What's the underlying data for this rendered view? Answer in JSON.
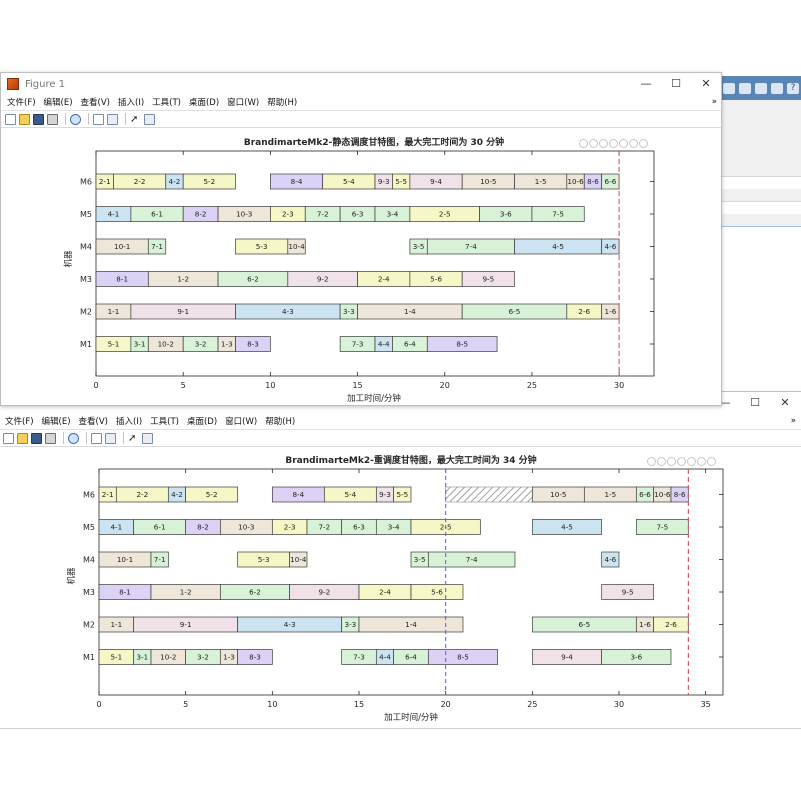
{
  "background_window": {
    "toolbar_icons": [
      "save-icon",
      "undo-icon",
      "redo-icon",
      "window-icon",
      "help-icon"
    ],
    "help_glyph": "?"
  },
  "figure1": {
    "title": "Figure 1",
    "window_controls": {
      "minimize": "—",
      "maximize": "☐",
      "close": "✕"
    },
    "menu": [
      "文件(F)",
      "编辑(E)",
      "查看(V)",
      "插入(I)",
      "工具(T)",
      "桌面(D)",
      "窗口(W)",
      "帮助(H)"
    ],
    "menu_overflow": "»",
    "toolbar_icons": [
      "new-file-icon",
      "open-folder-icon",
      "save-icon",
      "print-icon",
      "zoom-icon",
      "link-icon",
      "data-cursor-icon",
      "pointer-icon",
      "inspector-icon"
    ]
  },
  "figure2": {
    "window_controls": {
      "minimize": "—",
      "maximize": "☐",
      "close": "✕"
    },
    "menu": [
      "文件(F)",
      "编辑(E)",
      "查看(V)",
      "插入(I)",
      "工具(T)",
      "桌面(D)",
      "窗口(W)",
      "帮助(H)"
    ],
    "menu_overflow": "»",
    "toolbar_icons": [
      "new-file-icon",
      "open-folder-icon",
      "save-icon",
      "print-icon",
      "zoom-icon",
      "link-icon",
      "data-cursor-icon",
      "pointer-icon",
      "inspector-icon"
    ]
  },
  "chart_data": [
    {
      "type": "gantt",
      "title": "BrandimarteMk2-静态调度甘特图，最大完工时间为 30 分钟",
      "xlabel": "加工时间/分钟",
      "ylabel": "机器",
      "xlim": [
        0,
        32
      ],
      "xticks": [
        0,
        5,
        10,
        15,
        20,
        25,
        30
      ],
      "machines": [
        "M1",
        "M2",
        "M3",
        "M4",
        "M5",
        "M6"
      ],
      "makespan": 30,
      "makespan_line_color": "#d9534f",
      "tasks": [
        {
          "machine": "M6",
          "label": "2-1",
          "start": 0,
          "end": 1,
          "color": "#f5f7c6"
        },
        {
          "machine": "M6",
          "label": "2-2",
          "start": 1,
          "end": 4,
          "color": "#f5f7c6"
        },
        {
          "machine": "M6",
          "label": "4-2",
          "start": 4,
          "end": 5,
          "color": "#cce3f2"
        },
        {
          "machine": "M6",
          "label": "5-2",
          "start": 5,
          "end": 8,
          "color": "#f5f7c6"
        },
        {
          "machine": "M6",
          "label": "8-4",
          "start": 10,
          "end": 13,
          "color": "#dcd2f5"
        },
        {
          "machine": "M6",
          "label": "5-4",
          "start": 13,
          "end": 16,
          "color": "#f5f7c6"
        },
        {
          "machine": "M6",
          "label": "9-3",
          "start": 16,
          "end": 17,
          "color": "#f0e2e8"
        },
        {
          "machine": "M6",
          "label": "5-5",
          "start": 17,
          "end": 18,
          "color": "#f5f7c6"
        },
        {
          "machine": "M6",
          "label": "9-4",
          "start": 18,
          "end": 21,
          "color": "#f0e2e8"
        },
        {
          "machine": "M6",
          "label": "10-5",
          "start": 21,
          "end": 24,
          "color": "#eee6d8"
        },
        {
          "machine": "M6",
          "label": "1-5",
          "start": 24,
          "end": 27,
          "color": "#eee6d8"
        },
        {
          "machine": "M6",
          "label": "10-6",
          "start": 27,
          "end": 28,
          "color": "#eee6d8"
        },
        {
          "machine": "M6",
          "label": "8-6",
          "start": 28,
          "end": 29,
          "color": "#dcd2f5"
        },
        {
          "machine": "M6",
          "label": "6-6",
          "start": 29,
          "end": 30,
          "color": "#d8f2d8"
        },
        {
          "machine": "M5",
          "label": "4-1",
          "start": 0,
          "end": 2,
          "color": "#cce3f2"
        },
        {
          "machine": "M5",
          "label": "6-1",
          "start": 2,
          "end": 5,
          "color": "#d8f2d8"
        },
        {
          "machine": "M5",
          "label": "8-2",
          "start": 5,
          "end": 7,
          "color": "#dcd2f5"
        },
        {
          "machine": "M5",
          "label": "10-3",
          "start": 7,
          "end": 10,
          "color": "#eee6d8"
        },
        {
          "machine": "M5",
          "label": "2-3",
          "start": 10,
          "end": 12,
          "color": "#f5f7c6"
        },
        {
          "machine": "M5",
          "label": "7-2",
          "start": 12,
          "end": 14,
          "color": "#d8f2d8"
        },
        {
          "machine": "M5",
          "label": "6-3",
          "start": 14,
          "end": 16,
          "color": "#d8f2d8"
        },
        {
          "machine": "M5",
          "label": "3-4",
          "start": 16,
          "end": 18,
          "color": "#d8f2d8"
        },
        {
          "machine": "M5",
          "label": "2-5",
          "start": 18,
          "end": 22,
          "color": "#f5f7c6"
        },
        {
          "machine": "M5",
          "label": "3-6",
          "start": 22,
          "end": 25,
          "color": "#d8f2d8"
        },
        {
          "machine": "M5",
          "label": "7-5",
          "start": 25,
          "end": 28,
          "color": "#d8f2d8"
        },
        {
          "machine": "M4",
          "label": "10-1",
          "start": 0,
          "end": 3,
          "color": "#eee6d8"
        },
        {
          "machine": "M4",
          "label": "7-1",
          "start": 3,
          "end": 4,
          "color": "#d8f2d8"
        },
        {
          "machine": "M4",
          "label": "5-3",
          "start": 8,
          "end": 11,
          "color": "#f5f7c6"
        },
        {
          "machine": "M4",
          "label": "10-4",
          "start": 11,
          "end": 12,
          "color": "#eee6d8"
        },
        {
          "machine": "M4",
          "label": "3-5",
          "start": 18,
          "end": 19,
          "color": "#d8f2d8"
        },
        {
          "machine": "M4",
          "label": "7-4",
          "start": 19,
          "end": 24,
          "color": "#d8f2d8"
        },
        {
          "machine": "M4",
          "label": "4-5",
          "start": 24,
          "end": 29,
          "color": "#cce3f2"
        },
        {
          "machine": "M4",
          "label": "4-6",
          "start": 29,
          "end": 30,
          "color": "#cce3f2"
        },
        {
          "machine": "M3",
          "label": "8-1",
          "start": 0,
          "end": 3,
          "color": "#dcd2f5"
        },
        {
          "machine": "M3",
          "label": "1-2",
          "start": 3,
          "end": 7,
          "color": "#eee6d8"
        },
        {
          "machine": "M3",
          "label": "6-2",
          "start": 7,
          "end": 11,
          "color": "#d8f2d8"
        },
        {
          "machine": "M3",
          "label": "9-2",
          "start": 11,
          "end": 15,
          "color": "#f0e2e8"
        },
        {
          "machine": "M3",
          "label": "2-4",
          "start": 15,
          "end": 18,
          "color": "#f5f7c6"
        },
        {
          "machine": "M3",
          "label": "5-6",
          "start": 18,
          "end": 21,
          "color": "#f5f7c6"
        },
        {
          "machine": "M3",
          "label": "9-5",
          "start": 21,
          "end": 24,
          "color": "#f0e2e8"
        },
        {
          "machine": "M2",
          "label": "1-1",
          "start": 0,
          "end": 2,
          "color": "#eee6d8"
        },
        {
          "machine": "M2",
          "label": "9-1",
          "start": 2,
          "end": 8,
          "color": "#f0e2e8"
        },
        {
          "machine": "M2",
          "label": "4-3",
          "start": 8,
          "end": 14,
          "color": "#cce3f2"
        },
        {
          "machine": "M2",
          "label": "3-3",
          "start": 14,
          "end": 15,
          "color": "#d8f2d8"
        },
        {
          "machine": "M2",
          "label": "1-4",
          "start": 15,
          "end": 21,
          "color": "#eee6d8"
        },
        {
          "machine": "M2",
          "label": "6-5",
          "start": 21,
          "end": 27,
          "color": "#d8f2d8"
        },
        {
          "machine": "M2",
          "label": "2-6",
          "start": 27,
          "end": 29,
          "color": "#f5f7c6"
        },
        {
          "machine": "M2",
          "label": "1-6",
          "start": 29,
          "end": 30,
          "color": "#eee6d8"
        },
        {
          "machine": "M1",
          "label": "5-1",
          "start": 0,
          "end": 2,
          "color": "#f5f7c6"
        },
        {
          "machine": "M1",
          "label": "3-1",
          "start": 2,
          "end": 3,
          "color": "#d8f2d8"
        },
        {
          "machine": "M1",
          "label": "10-2",
          "start": 3,
          "end": 5,
          "color": "#eee6d8"
        },
        {
          "machine": "M1",
          "label": "3-2",
          "start": 5,
          "end": 7,
          "color": "#d8f2d8"
        },
        {
          "machine": "M1",
          "label": "1-3",
          "start": 7,
          "end": 8,
          "color": "#eee6d8"
        },
        {
          "machine": "M1",
          "label": "8-3",
          "start": 8,
          "end": 10,
          "color": "#dcd2f5"
        },
        {
          "machine": "M1",
          "label": "7-3",
          "start": 14,
          "end": 16,
          "color": "#d8f2d8"
        },
        {
          "machine": "M1",
          "label": "4-4",
          "start": 16,
          "end": 17,
          "color": "#cce3f2"
        },
        {
          "machine": "M1",
          "label": "6-4",
          "start": 17,
          "end": 19,
          "color": "#d8f2d8"
        },
        {
          "machine": "M1",
          "label": "8-5",
          "start": 19,
          "end": 23,
          "color": "#dcd2f5"
        }
      ]
    },
    {
      "type": "gantt",
      "title": "BrandimarteMk2-重调度甘特图，最大完工时间为 34 分钟",
      "xlabel": "加工时间/分钟",
      "ylabel": "机器",
      "xlim": [
        0,
        36
      ],
      "xticks": [
        0,
        5,
        10,
        15,
        20,
        25,
        30,
        35
      ],
      "machines": [
        "M1",
        "M2",
        "M3",
        "M4",
        "M5",
        "M6"
      ],
      "makespan": 34,
      "makespan_line_color": "#d9534f",
      "reschedule_time": 20,
      "reschedule_line_color": "#5b6fd6",
      "breakdown": {
        "machine": "M6",
        "start": 20,
        "end": 25
      },
      "tasks": [
        {
          "machine": "M6",
          "label": "2-1",
          "start": 0,
          "end": 1,
          "color": "#f5f7c6"
        },
        {
          "machine": "M6",
          "label": "2-2",
          "start": 1,
          "end": 4,
          "color": "#f5f7c6"
        },
        {
          "machine": "M6",
          "label": "4-2",
          "start": 4,
          "end": 5,
          "color": "#cce3f2"
        },
        {
          "machine": "M6",
          "label": "5-2",
          "start": 5,
          "end": 8,
          "color": "#f5f7c6"
        },
        {
          "machine": "M6",
          "label": "8-4",
          "start": 10,
          "end": 13,
          "color": "#dcd2f5"
        },
        {
          "machine": "M6",
          "label": "5-4",
          "start": 13,
          "end": 16,
          "color": "#f5f7c6"
        },
        {
          "machine": "M6",
          "label": "9-3",
          "start": 16,
          "end": 17,
          "color": "#f0e2e8"
        },
        {
          "machine": "M6",
          "label": "5-5",
          "start": 17,
          "end": 18,
          "color": "#f5f7c6"
        },
        {
          "machine": "M6",
          "label": "10-5",
          "start": 25,
          "end": 28,
          "color": "#eee6d8"
        },
        {
          "machine": "M6",
          "label": "1-5",
          "start": 28,
          "end": 31,
          "color": "#eee6d8"
        },
        {
          "machine": "M6",
          "label": "6-6",
          "start": 31,
          "end": 32,
          "color": "#d8f2d8"
        },
        {
          "machine": "M6",
          "label": "10-6",
          "start": 32,
          "end": 33,
          "color": "#eee6d8"
        },
        {
          "machine": "M6",
          "label": "8-6",
          "start": 33,
          "end": 34,
          "color": "#dcd2f5"
        },
        {
          "machine": "M5",
          "label": "4-1",
          "start": 0,
          "end": 2,
          "color": "#cce3f2"
        },
        {
          "machine": "M5",
          "label": "6-1",
          "start": 2,
          "end": 5,
          "color": "#d8f2d8"
        },
        {
          "machine": "M5",
          "label": "8-2",
          "start": 5,
          "end": 7,
          "color": "#dcd2f5"
        },
        {
          "machine": "M5",
          "label": "10-3",
          "start": 7,
          "end": 10,
          "color": "#eee6d8"
        },
        {
          "machine": "M5",
          "label": "2-3",
          "start": 10,
          "end": 12,
          "color": "#f5f7c6"
        },
        {
          "machine": "M5",
          "label": "7-2",
          "start": 12,
          "end": 14,
          "color": "#d8f2d8"
        },
        {
          "machine": "M5",
          "label": "6-3",
          "start": 14,
          "end": 16,
          "color": "#d8f2d8"
        },
        {
          "machine": "M5",
          "label": "3-4",
          "start": 16,
          "end": 18,
          "color": "#d8f2d8"
        },
        {
          "machine": "M5",
          "label": "2-5",
          "start": 18,
          "end": 22,
          "color": "#f5f7c6"
        },
        {
          "machine": "M5",
          "label": "4-5",
          "start": 25,
          "end": 29,
          "color": "#cce3f2"
        },
        {
          "machine": "M5",
          "label": "7-5",
          "start": 31,
          "end": 34,
          "color": "#d8f2d8"
        },
        {
          "machine": "M4",
          "label": "10-1",
          "start": 0,
          "end": 3,
          "color": "#eee6d8"
        },
        {
          "machine": "M4",
          "label": "7-1",
          "start": 3,
          "end": 4,
          "color": "#d8f2d8"
        },
        {
          "machine": "M4",
          "label": "5-3",
          "start": 8,
          "end": 11,
          "color": "#f5f7c6"
        },
        {
          "machine": "M4",
          "label": "10-4",
          "start": 11,
          "end": 12,
          "color": "#eee6d8"
        },
        {
          "machine": "M4",
          "label": "3-5",
          "start": 18,
          "end": 19,
          "color": "#d8f2d8"
        },
        {
          "machine": "M4",
          "label": "7-4",
          "start": 19,
          "end": 24,
          "color": "#d8f2d8"
        },
        {
          "machine": "M4",
          "label": "4-6",
          "start": 29,
          "end": 30,
          "color": "#cce3f2"
        },
        {
          "machine": "M3",
          "label": "8-1",
          "start": 0,
          "end": 3,
          "color": "#dcd2f5"
        },
        {
          "machine": "M3",
          "label": "1-2",
          "start": 3,
          "end": 7,
          "color": "#eee6d8"
        },
        {
          "machine": "M3",
          "label": "6-2",
          "start": 7,
          "end": 11,
          "color": "#d8f2d8"
        },
        {
          "machine": "M3",
          "label": "9-2",
          "start": 11,
          "end": 15,
          "color": "#f0e2e8"
        },
        {
          "machine": "M3",
          "label": "2-4",
          "start": 15,
          "end": 18,
          "color": "#f5f7c6"
        },
        {
          "machine": "M3",
          "label": "5-6",
          "start": 18,
          "end": 21,
          "color": "#f5f7c6"
        },
        {
          "machine": "M3",
          "label": "9-5",
          "start": 29,
          "end": 32,
          "color": "#f0e2e8"
        },
        {
          "machine": "M2",
          "label": "1-1",
          "start": 0,
          "end": 2,
          "color": "#eee6d8"
        },
        {
          "machine": "M2",
          "label": "9-1",
          "start": 2,
          "end": 8,
          "color": "#f0e2e8"
        },
        {
          "machine": "M2",
          "label": "4-3",
          "start": 8,
          "end": 14,
          "color": "#cce3f2"
        },
        {
          "machine": "M2",
          "label": "3-3",
          "start": 14,
          "end": 15,
          "color": "#d8f2d8"
        },
        {
          "machine": "M2",
          "label": "1-4",
          "start": 15,
          "end": 21,
          "color": "#eee6d8"
        },
        {
          "machine": "M2",
          "label": "6-5",
          "start": 25,
          "end": 31,
          "color": "#d8f2d8"
        },
        {
          "machine": "M2",
          "label": "1-6",
          "start": 31,
          "end": 32,
          "color": "#eee6d8"
        },
        {
          "machine": "M2",
          "label": "2-6",
          "start": 32,
          "end": 34,
          "color": "#f5f7c6"
        },
        {
          "machine": "M1",
          "label": "5-1",
          "start": 0,
          "end": 2,
          "color": "#f5f7c6"
        },
        {
          "machine": "M1",
          "label": "3-1",
          "start": 2,
          "end": 3,
          "color": "#d8f2d8"
        },
        {
          "machine": "M1",
          "label": "10-2",
          "start": 3,
          "end": 5,
          "color": "#eee6d8"
        },
        {
          "machine": "M1",
          "label": "3-2",
          "start": 5,
          "end": 7,
          "color": "#d8f2d8"
        },
        {
          "machine": "M1",
          "label": "1-3",
          "start": 7,
          "end": 8,
          "color": "#eee6d8"
        },
        {
          "machine": "M1",
          "label": "8-3",
          "start": 8,
          "end": 10,
          "color": "#dcd2f5"
        },
        {
          "machine": "M1",
          "label": "7-3",
          "start": 14,
          "end": 16,
          "color": "#d8f2d8"
        },
        {
          "machine": "M1",
          "label": "4-4",
          "start": 16,
          "end": 17,
          "color": "#cce3f2"
        },
        {
          "machine": "M1",
          "label": "6-4",
          "start": 17,
          "end": 19,
          "color": "#d8f2d8"
        },
        {
          "machine": "M1",
          "label": "8-5",
          "start": 19,
          "end": 23,
          "color": "#dcd2f5"
        },
        {
          "machine": "M1",
          "label": "9-4",
          "start": 25,
          "end": 29,
          "color": "#f0e2e8"
        },
        {
          "machine": "M1",
          "label": "3-6",
          "start": 29,
          "end": 33,
          "color": "#d8f2d8"
        }
      ]
    }
  ]
}
